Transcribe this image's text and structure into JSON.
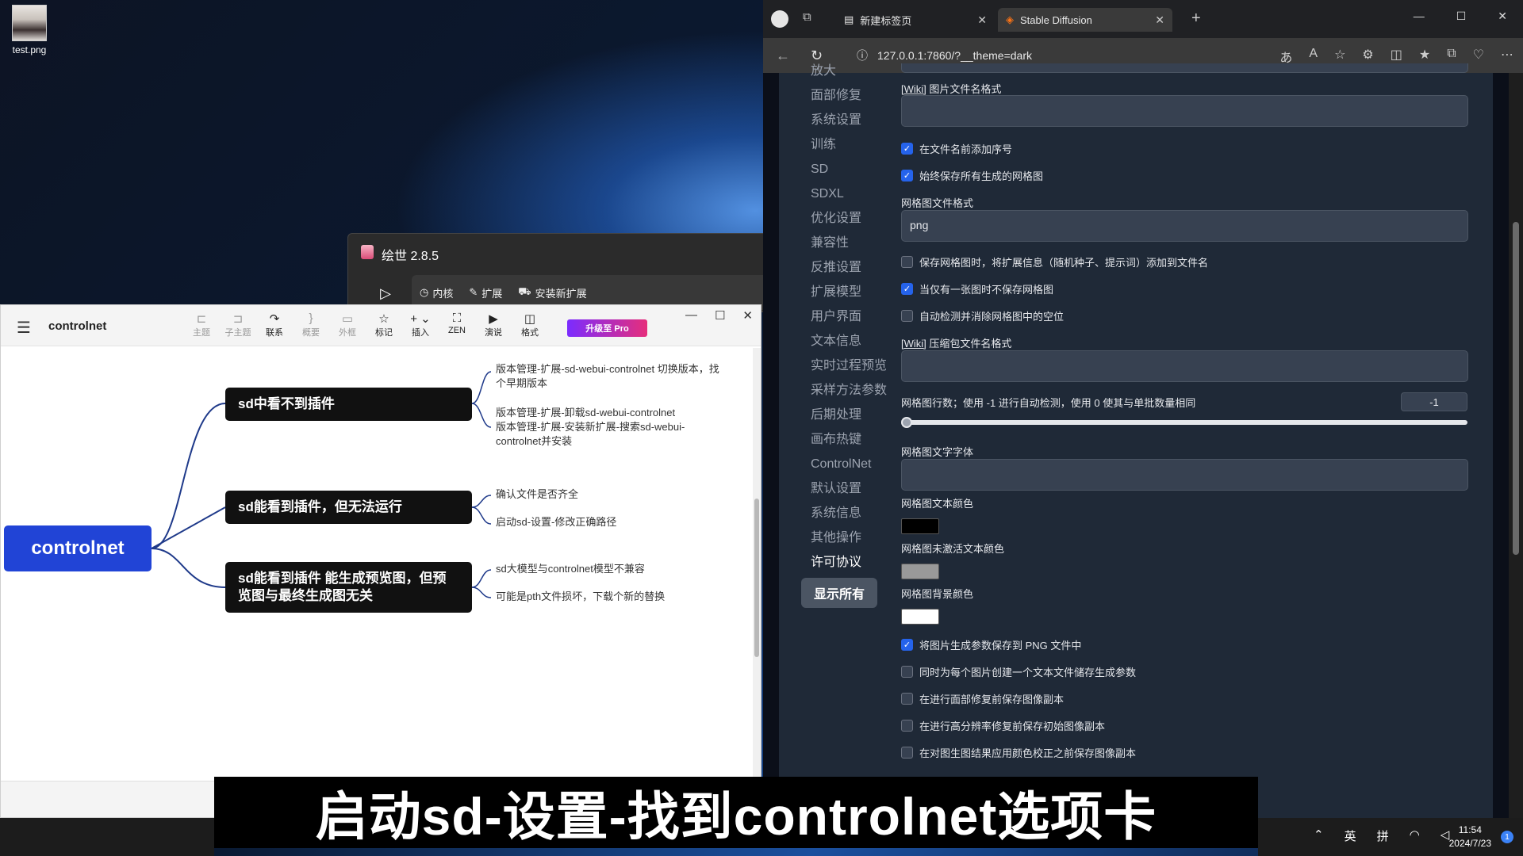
{
  "desktop": {
    "icon_label": "test.png"
  },
  "launcher": {
    "title": "绘世 2.8.5",
    "tabs": [
      "内核",
      "扩展",
      "安装新扩展"
    ]
  },
  "mindmap": {
    "doc_title": "controlnet",
    "tools": [
      "主题",
      "子主题",
      "联系",
      "概要",
      "外框",
      "标记",
      "插入",
      "ZEN",
      "演说",
      "格式"
    ],
    "pro_label": "升级至 Pro",
    "root": "controlnet",
    "branches": [
      {
        "label": "sd中看不到插件",
        "leaves": [
          "版本管理-扩展-sd-webui-controlnet 切换版本，找个早期版本",
          "版本管理-扩展-卸载sd-webui-controlnet\n版本管理-扩展-安装新扩展-搜索sd-webui-controlnet并安装"
        ]
      },
      {
        "label": "sd能看到插件，但无法运行",
        "leaves": [
          "确认文件是否齐全",
          "启动sd-设置-修改正确路径"
        ]
      },
      {
        "label": "sd能看到插件 能生成预览图，但预览图与最终生成图无关",
        "leaves": [
          "sd大模型与controlnet模型不兼容",
          "可能是pth文件损坏，下载个新的替换"
        ]
      }
    ]
  },
  "browser": {
    "tabs": [
      {
        "label": "新建标签页"
      },
      {
        "label": "Stable Diffusion"
      }
    ],
    "url": "127.0.0.1:7860/?__theme=dark"
  },
  "settings": {
    "nav": [
      "放大",
      "面部修复",
      "系统设置",
      "训练",
      "SD",
      "SDXL",
      "优化设置",
      "兼容性",
      "反推设置",
      "扩展模型",
      "用户界面",
      "文本信息",
      "实时过程预览",
      "采样方法参数",
      "后期处理",
      "画布热键",
      "ControlNet",
      "默认设置",
      "系统信息",
      "其他操作",
      "许可协议"
    ],
    "show_all": "显示所有",
    "wiki_link": "[Wiki]",
    "image_filename_label": "图片文件名格式",
    "cb_add_index": "在文件名前添加序号",
    "cb_save_grid": "始终保存所有生成的网格图",
    "grid_format_label": "网格图文件格式",
    "grid_format_value": "png",
    "cb_grid_extended": "保存网格图时，将扩展信息（随机种子、提示词）添加到文件名",
    "cb_no_single_grid": "当仅有一张图时不保存网格图",
    "cb_auto_trim": "自动检测并消除网格图中的空位",
    "zip_filename_label": "压缩包文件名格式",
    "grid_rows_label": "网格图行数；使用 -1 进行自动检测，使用 0 使其与单批数量相同",
    "grid_rows_value": "-1",
    "grid_font_label": "网格图文字字体",
    "grid_text_color_label": "网格图文本颜色",
    "grid_inactive_color_label": "网格图未激活文本颜色",
    "grid_bg_color_label": "网格图背景颜色",
    "colors": {
      "text": "#000000",
      "inactive": "#999999",
      "background": "#ffffff"
    },
    "cb_png_params": "将图片生成参数保存到 PNG 文件中",
    "cb_txt_params": "同时为每个图片创建一个文本文件储存生成参数",
    "cb_before_face": "在进行面部修复前保存图像副本",
    "cb_before_hires": "在进行高分辨率修复前保存初始图像副本",
    "cb_before_color": "在对图生图结果应用颜色校正之前保存图像副本"
  },
  "caption": "启动sd-设置-找到controlnet选项卡",
  "taskbar": {
    "ime_lang": "英",
    "ime_mode": "拼",
    "time": "11:54",
    "date": "2024/7/23",
    "notif_count": "1"
  }
}
